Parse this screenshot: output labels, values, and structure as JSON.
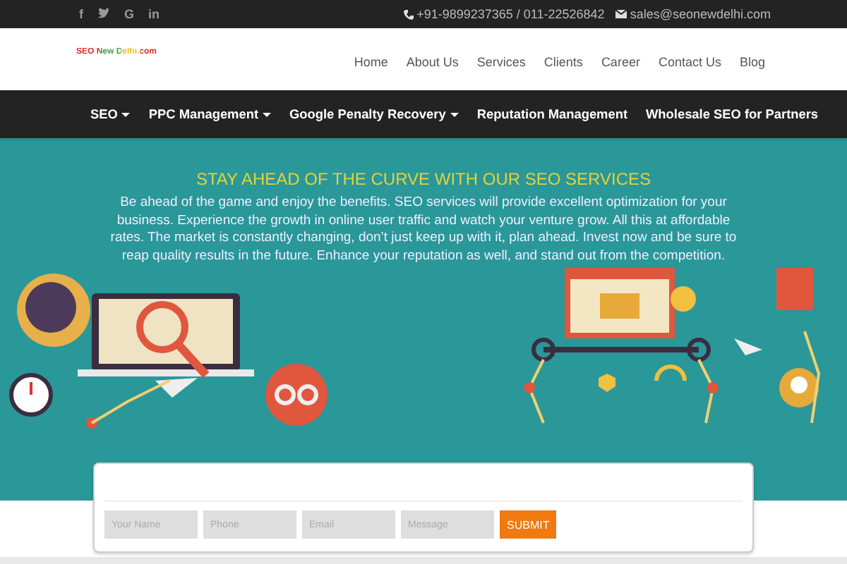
{
  "top_bar": {
    "socials": [
      {
        "kind": "facebook",
        "glyph": "f"
      },
      {
        "kind": "twitter"
      },
      {
        "kind": "google",
        "glyph": "G"
      },
      {
        "kind": "linkedin",
        "glyph": "in"
      }
    ],
    "phone": "+91-9899237365 / 011-22526842",
    "email": "sales@seonewdelhi.com"
  },
  "header": {
    "logo": "SEO New Delhi.com",
    "menu": [
      "Home",
      "About Us",
      "Services",
      "Clients",
      "Career",
      "Contact Us",
      "Blog"
    ]
  },
  "main_nav": [
    {
      "label": "SEO",
      "dropdown": true
    },
    {
      "label": "PPC Management",
      "dropdown": true
    },
    {
      "label": "Google Penalty Recovery",
      "dropdown": true
    },
    {
      "label": "Reputation Management",
      "dropdown": false
    },
    {
      "label": "Wholesale SEO for Partners",
      "dropdown": false
    }
  ],
  "hero": {
    "title": "STAY AHEAD OF THE CURVE WITH OUR SEO SERVICES",
    "text": "Be ahead of the game and enjoy the benefits. SEO services will provide excellent optimization for your business. Experience the growth in online user traffic and watch your venture grow. All this at affordable rates. The market is constantly changing, don’t just keep up with it, plan ahead. Invest now and be sure to reap quality results in the future. Enhance your reputation as well, and stand out from the competition."
  },
  "contact_form": {
    "fields": [
      {
        "placeholder": "Your Name"
      },
      {
        "placeholder": "Phone"
      },
      {
        "placeholder": "Email"
      },
      {
        "placeholder": "Message"
      }
    ],
    "submit": "SUBMIT"
  }
}
